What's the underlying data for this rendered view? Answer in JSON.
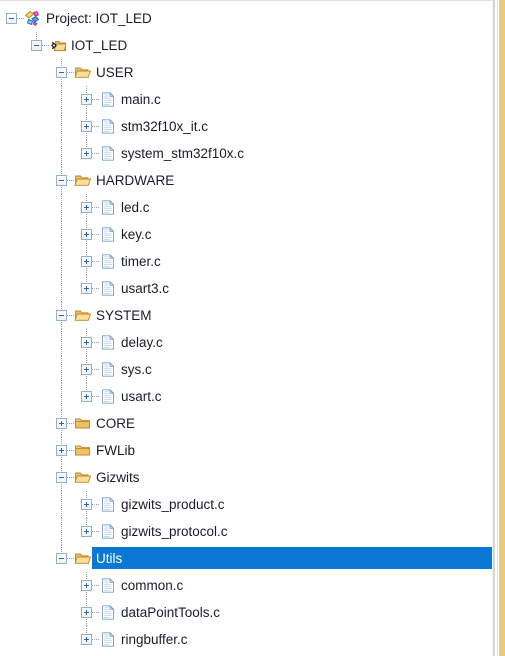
{
  "panel": {
    "name": "project-explorer",
    "accent_selection_color": "#0a78d4",
    "selection_text_color": "#ffffff",
    "text_color": "#1b1b2e",
    "background_color": "#ffffff",
    "right_strip_color": "#ecc975"
  },
  "tree": {
    "rows": [
      {
        "label": "Project: IOT_LED",
        "depth": 0,
        "toggle": "minus",
        "icon": "project-icon"
      },
      {
        "label": "IOT_LED",
        "depth": 1,
        "toggle": "minus",
        "icon": "target-folder-icon"
      },
      {
        "label": "USER",
        "depth": 2,
        "toggle": "minus",
        "icon": "folder-open-icon"
      },
      {
        "label": "main.c",
        "depth": 3,
        "toggle": "plus",
        "icon": "c-file-icon"
      },
      {
        "label": "stm32f10x_it.c",
        "depth": 3,
        "toggle": "plus",
        "icon": "c-file-icon"
      },
      {
        "label": "system_stm32f10x.c",
        "depth": 3,
        "toggle": "plus",
        "icon": "c-file-icon"
      },
      {
        "label": "HARDWARE",
        "depth": 2,
        "toggle": "minus",
        "icon": "folder-open-icon"
      },
      {
        "label": "led.c",
        "depth": 3,
        "toggle": "plus",
        "icon": "c-file-icon"
      },
      {
        "label": "key.c",
        "depth": 3,
        "toggle": "plus",
        "icon": "c-file-icon"
      },
      {
        "label": "timer.c",
        "depth": 3,
        "toggle": "plus",
        "icon": "c-file-icon"
      },
      {
        "label": "usart3.c",
        "depth": 3,
        "toggle": "plus",
        "icon": "c-file-icon"
      },
      {
        "label": "SYSTEM",
        "depth": 2,
        "toggle": "minus",
        "icon": "folder-open-icon"
      },
      {
        "label": "delay.c",
        "depth": 3,
        "toggle": "plus",
        "icon": "c-file-icon"
      },
      {
        "label": "sys.c",
        "depth": 3,
        "toggle": "plus",
        "icon": "c-file-icon"
      },
      {
        "label": "usart.c",
        "depth": 3,
        "toggle": "plus",
        "icon": "c-file-icon"
      },
      {
        "label": "CORE",
        "depth": 2,
        "toggle": "plus",
        "icon": "folder-closed-icon"
      },
      {
        "label": "FWLib",
        "depth": 2,
        "toggle": "plus",
        "icon": "folder-closed-icon"
      },
      {
        "label": "Gizwits",
        "depth": 2,
        "toggle": "minus",
        "icon": "folder-open-icon"
      },
      {
        "label": "gizwits_product.c",
        "depth": 3,
        "toggle": "plus",
        "icon": "c-file-icon"
      },
      {
        "label": "gizwits_protocol.c",
        "depth": 3,
        "toggle": "plus",
        "icon": "c-file-icon"
      },
      {
        "label": "Utils",
        "depth": 2,
        "toggle": "minus",
        "icon": "folder-open-icon",
        "selected": true
      },
      {
        "label": "common.c",
        "depth": 3,
        "toggle": "plus",
        "icon": "c-file-icon"
      },
      {
        "label": "dataPointTools.c",
        "depth": 3,
        "toggle": "plus",
        "icon": "c-file-icon"
      },
      {
        "label": "ringbuffer.c",
        "depth": 3,
        "toggle": "plus",
        "icon": "c-file-icon"
      }
    ]
  }
}
